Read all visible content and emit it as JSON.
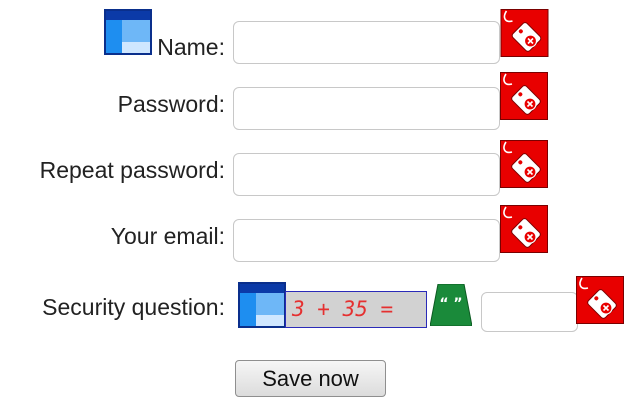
{
  "form": {
    "name_label": "Name:",
    "password_label": "Password:",
    "repeat_password_label": "Repeat password:",
    "email_label": "Your email:",
    "security_question_label": "Security question:",
    "name_value": "",
    "password_value": "",
    "repeat_password_value": "",
    "email_value": "",
    "security_answer_value": "",
    "captcha_expression": "3 + 35 =",
    "save_label": "Save now"
  },
  "icons": {
    "validation": "price-tag-error-icon",
    "field_info": "window-icon",
    "quote": "quote-icon"
  },
  "colors": {
    "error_red": "#e80000",
    "captcha_text": "#e53030",
    "quote_green": "#1a8a3a",
    "window_blue": "#1e6fd0"
  }
}
